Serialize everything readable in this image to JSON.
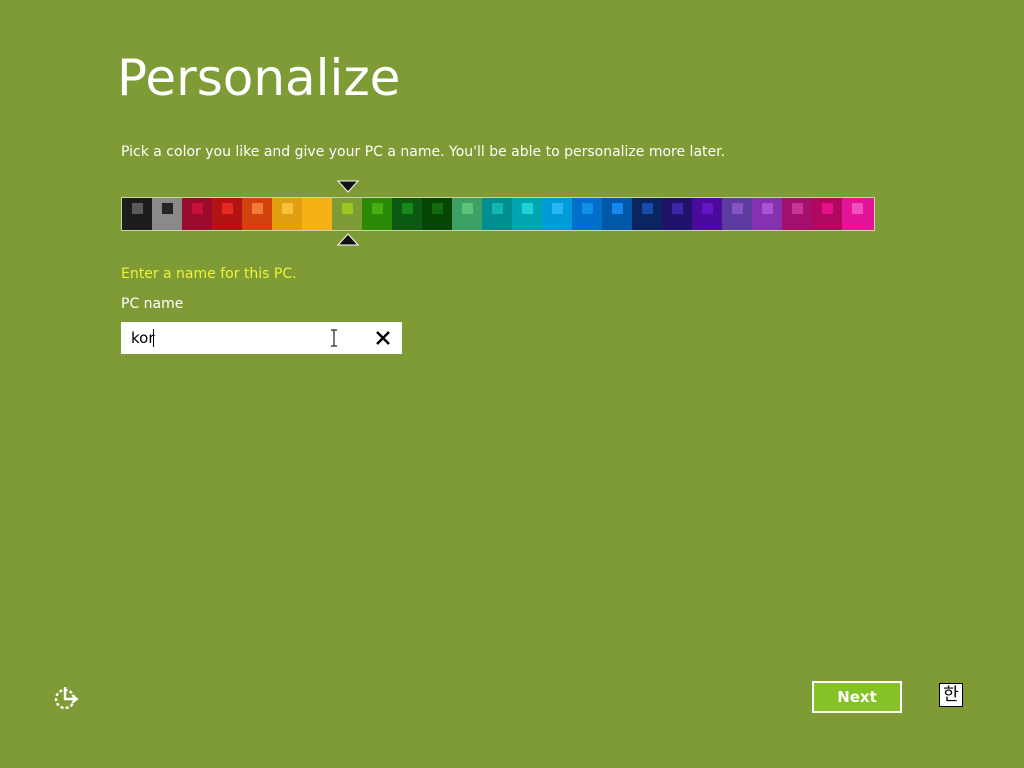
{
  "page": {
    "title": "Personalize",
    "instructions": "Pick a color you like and give your PC a name. You'll be able to personalize more later."
  },
  "color_picker": {
    "selected_index": 7,
    "swatches": [
      {
        "bg": "#1d1d1d",
        "fg": "#5a5a5a"
      },
      {
        "bg": "#8a8a8a",
        "fg": "#252525"
      },
      {
        "bg": "#9b0b2e",
        "fg": "#c4123d"
      },
      {
        "bg": "#b31313",
        "fg": "#e22a21"
      },
      {
        "bg": "#d1420f",
        "fg": "#f17a3a"
      },
      {
        "bg": "#e39f12",
        "fg": "#f7c23a"
      },
      {
        "bg": "#f5b116",
        "fg": "#f5b116"
      },
      {
        "bg": "#7e9b35",
        "fg": "#9dc623"
      },
      {
        "bg": "#2c8b06",
        "fg": "#48ad12"
      },
      {
        "bg": "#0c5a12",
        "fg": "#17881b"
      },
      {
        "bg": "#064503",
        "fg": "#0f6b0b"
      },
      {
        "bg": "#3da166",
        "fg": "#5bc47c"
      },
      {
        "bg": "#008f8e",
        "fg": "#12b7b1"
      },
      {
        "bg": "#00a5b0",
        "fg": "#1cd3d6"
      },
      {
        "bg": "#009cd9",
        "fg": "#29b6f6"
      },
      {
        "bg": "#006fc9",
        "fg": "#1290e8"
      },
      {
        "bg": "#0058a8",
        "fg": "#1389f0"
      },
      {
        "bg": "#0a255f",
        "fg": "#174cad"
      },
      {
        "bg": "#20136b",
        "fg": "#3c27a5"
      },
      {
        "bg": "#4b0a9b",
        "fg": "#6415c2"
      },
      {
        "bg": "#5c3c9e",
        "fg": "#8553c4"
      },
      {
        "bg": "#8532b1",
        "fg": "#aa53d6"
      },
      {
        "bg": "#a30f6c",
        "fg": "#c63596"
      },
      {
        "bg": "#b1085f",
        "fg": "#e4118b"
      },
      {
        "bg": "#e31497",
        "fg": "#f04fbc"
      }
    ]
  },
  "form": {
    "hint": "Enter a name for this PC.",
    "label": "PC name",
    "value": "kor",
    "clear_icon": "close-icon"
  },
  "footer": {
    "next_label": "Next",
    "ime_label": "한",
    "ease_icon": "ease-of-access-icon"
  }
}
